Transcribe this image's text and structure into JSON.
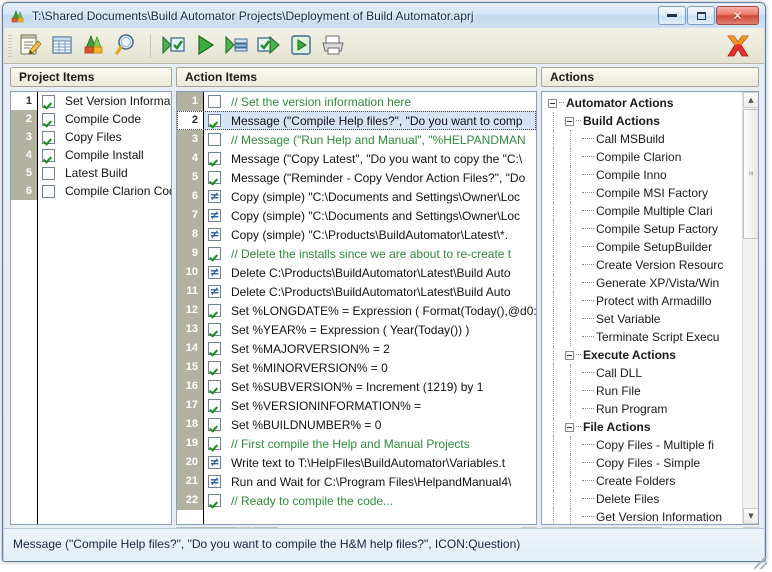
{
  "window": {
    "title": "T:\\Shared Documents\\Build Automator Projects\\Deployment of Build Automator.aprj",
    "app_icon": "build-automator-icon",
    "minimize_label": "",
    "maximize_label": "",
    "close_label": "✕"
  },
  "toolbar": {
    "buttons": [
      {
        "name": "new-project-icon",
        "tip": "New Project"
      },
      {
        "name": "project-list-icon",
        "tip": "Project List"
      },
      {
        "name": "open-project-icon",
        "tip": "Open Project"
      },
      {
        "name": "search-icon",
        "tip": "Find"
      },
      {
        "name": "run-checked-icon",
        "tip": "Run Checked Actions"
      },
      {
        "name": "run-icon",
        "tip": "Run"
      },
      {
        "name": "run-step-icon",
        "tip": "Run Step"
      },
      {
        "name": "check-run-icon",
        "tip": "Check and Run"
      },
      {
        "name": "run-all-icon",
        "tip": "Run All"
      },
      {
        "name": "print-icon",
        "tip": "Print"
      }
    ],
    "close_x_icon": "exit-x-icon"
  },
  "project_panel": {
    "header": "Project Items",
    "rows": [
      {
        "num": "1",
        "label": "Set Version Information",
        "checked": true,
        "selected": true
      },
      {
        "num": "2",
        "label": "Compile Code",
        "checked": true,
        "selected": false
      },
      {
        "num": "3",
        "label": "Copy Files",
        "checked": true,
        "selected": false
      },
      {
        "num": "4",
        "label": "Compile Install",
        "checked": true,
        "selected": false
      },
      {
        "num": "5",
        "label": "Latest Build",
        "checked": false,
        "selected": false
      },
      {
        "num": "6",
        "label": "Compile Clarion Code",
        "checked": false,
        "selected": false
      }
    ]
  },
  "action_panel": {
    "header": "Action Items",
    "rows": [
      {
        "num": "1",
        "state": "unchecked",
        "comment": true,
        "selected": false,
        "text": "// Set the version information here"
      },
      {
        "num": "2",
        "state": "checked",
        "comment": false,
        "selected": true,
        "text": "Message (\"Compile Help files?\", \"Do you want to comp"
      },
      {
        "num": "3",
        "state": "unchecked",
        "comment": true,
        "selected": false,
        "text": "// Message (\"Run Help and Manual\", \"%HELPANDMAN"
      },
      {
        "num": "4",
        "state": "checked",
        "comment": false,
        "selected": false,
        "text": "Message (\"Copy Latest\", \"Do you want to copy the \"C:\\"
      },
      {
        "num": "5",
        "state": "checked",
        "comment": false,
        "selected": false,
        "text": "Message (\"Reminder - Copy Vendor Action Files?\", \"Do"
      },
      {
        "num": "6",
        "state": "notequal",
        "comment": false,
        "selected": false,
        "text": "Copy (simple) \"C:\\Documents and Settings\\Owner\\Loc"
      },
      {
        "num": "7",
        "state": "notequal",
        "comment": false,
        "selected": false,
        "text": "Copy (simple) \"C:\\Documents and Settings\\Owner\\Loc"
      },
      {
        "num": "8",
        "state": "notequal",
        "comment": false,
        "selected": false,
        "text": "Copy (simple) \"C:\\Products\\BuildAutomator\\Latest\\*."
      },
      {
        "num": "9",
        "state": "checked",
        "comment": true,
        "selected": false,
        "text": "// Delete the installs since we are about to re-create t"
      },
      {
        "num": "10",
        "state": "notequal",
        "comment": false,
        "selected": false,
        "text": "Delete C:\\Products\\BuildAutomator\\Latest\\Build Auto"
      },
      {
        "num": "11",
        "state": "notequal",
        "comment": false,
        "selected": false,
        "text": "Delete C:\\Products\\BuildAutomator\\Latest\\Build Auto"
      },
      {
        "num": "12",
        "state": "checked",
        "comment": false,
        "selected": false,
        "text": "Set %LONGDATE% = Expression ( Format(Today(),@d0:"
      },
      {
        "num": "13",
        "state": "checked",
        "comment": false,
        "selected": false,
        "text": "Set %YEAR% = Expression ( Year(Today()) )"
      },
      {
        "num": "14",
        "state": "checked",
        "comment": false,
        "selected": false,
        "text": "Set %MAJORVERSION% =  2"
      },
      {
        "num": "15",
        "state": "checked",
        "comment": false,
        "selected": false,
        "text": "Set %MINORVERSION% =  0"
      },
      {
        "num": "16",
        "state": "checked",
        "comment": false,
        "selected": false,
        "text": "Set %SUBVERSION% = Increment (1219) by 1"
      },
      {
        "num": "17",
        "state": "checked",
        "comment": false,
        "selected": false,
        "text": "Set %VERSIONINFORMATION% ="
      },
      {
        "num": "18",
        "state": "checked",
        "comment": false,
        "selected": false,
        "text": "Set %BUILDNUMBER% =  0"
      },
      {
        "num": "19",
        "state": "checked",
        "comment": true,
        "selected": false,
        "text": "// First compile the Help and Manual Projects"
      },
      {
        "num": "20",
        "state": "notequal",
        "comment": false,
        "selected": false,
        "text": "Write text to T:\\HelpFiles\\BuildAutomator\\Variables.t"
      },
      {
        "num": "21",
        "state": "notequal",
        "comment": false,
        "selected": false,
        "text": "Run and Wait for C:\\Program Files\\HelpandManual4\\"
      },
      {
        "num": "22",
        "state": "checked",
        "comment": true,
        "selected": false,
        "text": "// Ready to compile the code..."
      }
    ]
  },
  "actions_panel": {
    "header": "Actions",
    "tree": [
      {
        "level": 0,
        "label": "Automator Actions",
        "expander": true,
        "bold": true
      },
      {
        "level": 1,
        "label": "Build Actions",
        "expander": true,
        "bold": true
      },
      {
        "level": 2,
        "label": "Call MSBuild",
        "expander": false,
        "bold": false
      },
      {
        "level": 2,
        "label": "Compile Clarion",
        "expander": false,
        "bold": false
      },
      {
        "level": 2,
        "label": "Compile Inno",
        "expander": false,
        "bold": false
      },
      {
        "level": 2,
        "label": "Compile MSI Factory",
        "expander": false,
        "bold": false
      },
      {
        "level": 2,
        "label": "Compile Multiple Clari",
        "expander": false,
        "bold": false
      },
      {
        "level": 2,
        "label": "Compile Setup Factory",
        "expander": false,
        "bold": false
      },
      {
        "level": 2,
        "label": "Compile SetupBuilder",
        "expander": false,
        "bold": false
      },
      {
        "level": 2,
        "label": "Create Version Resourc",
        "expander": false,
        "bold": false
      },
      {
        "level": 2,
        "label": "Generate XP/Vista/Win",
        "expander": false,
        "bold": false
      },
      {
        "level": 2,
        "label": "Protect with Armadillo",
        "expander": false,
        "bold": false
      },
      {
        "level": 2,
        "label": "Set Variable",
        "expander": false,
        "bold": false
      },
      {
        "level": 2,
        "label": "Terminate Script Execu",
        "expander": false,
        "bold": false
      },
      {
        "level": 1,
        "label": "Execute Actions",
        "expander": true,
        "bold": true
      },
      {
        "level": 2,
        "label": "Call DLL",
        "expander": false,
        "bold": false
      },
      {
        "level": 2,
        "label": "Run File",
        "expander": false,
        "bold": false
      },
      {
        "level": 2,
        "label": "Run Program",
        "expander": false,
        "bold": false
      },
      {
        "level": 1,
        "label": "File Actions",
        "expander": true,
        "bold": true
      },
      {
        "level": 2,
        "label": "Copy Files - Multiple fi",
        "expander": false,
        "bold": false
      },
      {
        "level": 2,
        "label": "Copy Files - Simple",
        "expander": false,
        "bold": false
      },
      {
        "level": 2,
        "label": "Create Folders",
        "expander": false,
        "bold": false
      },
      {
        "level": 2,
        "label": "Delete Files",
        "expander": false,
        "bold": false
      },
      {
        "level": 2,
        "label": "Get Version Information",
        "expander": false,
        "bold": false
      }
    ]
  },
  "scrollbars": {
    "up_arrow": "▲",
    "down_arrow": "▼",
    "left_arrow": "◀",
    "right_arrow": "▶",
    "grip_v": "≡",
    "grip_h": "‖"
  },
  "statusbar": {
    "text": "Message (\"Compile Help files?\", \"Do you want to compile the H&M help files?\", ICON:Question)"
  }
}
